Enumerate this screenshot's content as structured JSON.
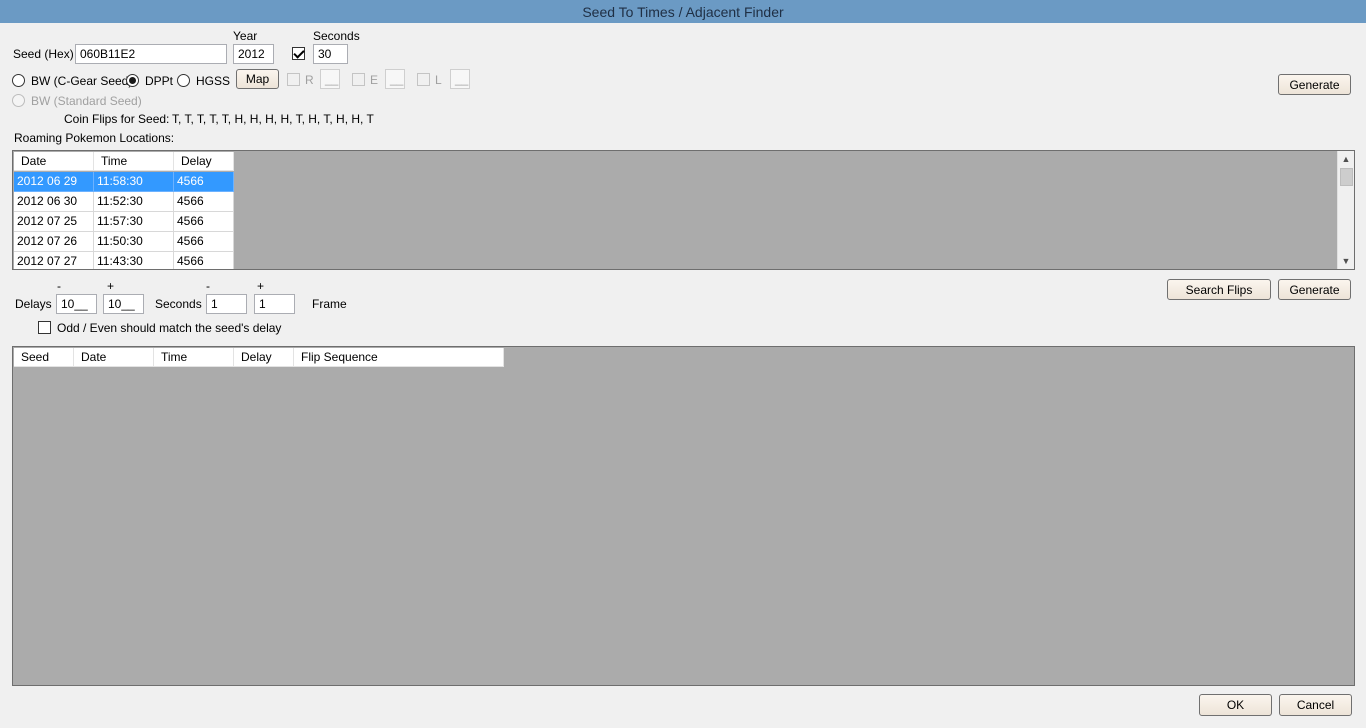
{
  "window": {
    "title": "Seed To Times / Adjacent Finder"
  },
  "seed": {
    "label": "Seed (Hex)",
    "value": "060B11E2",
    "year_label": "Year",
    "year_value": "2012",
    "seconds_label": "Seconds",
    "seconds_value": "30"
  },
  "versions": {
    "bw_cgear": "BW (C-Gear Seed)",
    "dppt": "DPPt",
    "hgss": "HGSS",
    "bw_standard": "BW (Standard Seed)"
  },
  "roamers": {
    "map_button": "Map",
    "r_label": "R",
    "r_value": "__",
    "e_label": "E",
    "e_value": "__",
    "l_label": "L",
    "l_value": "__"
  },
  "generate_top": "Generate",
  "coin_flips": {
    "label": "Coin Flips for Seed:",
    "value": "T, T, T, T, T, H, H, H, H, T, H, T, H, H, T"
  },
  "roaming_label": "Roaming Pokemon Locations:",
  "times_grid": {
    "headers": [
      "Date",
      "Time",
      "Delay"
    ],
    "rows": [
      [
        "2012 06 29",
        "11:58:30",
        "4566"
      ],
      [
        "2012 06 30",
        "11:52:30",
        "4566"
      ],
      [
        "2012 07 25",
        "11:57:30",
        "4566"
      ],
      [
        "2012 07 26",
        "11:50:30",
        "4566"
      ],
      [
        "2012 07 27",
        "11:43:30",
        "4566"
      ]
    ]
  },
  "adjacent": {
    "minus": "-",
    "plus": "+",
    "delays_label": "Delays",
    "delay_minus": "10__",
    "delay_plus": "10__",
    "seconds_label": "Seconds",
    "seconds_minus": "1",
    "seconds_plus": "1",
    "frame_label": "Frame",
    "search_flips": "Search Flips",
    "generate": "Generate",
    "odd_even_label": "Odd / Even should match the seed's delay"
  },
  "results_grid": {
    "headers": [
      "Seed",
      "Date",
      "Time",
      "Delay",
      "Flip Sequence"
    ]
  },
  "footer": {
    "ok": "OK",
    "cancel": "Cancel"
  }
}
